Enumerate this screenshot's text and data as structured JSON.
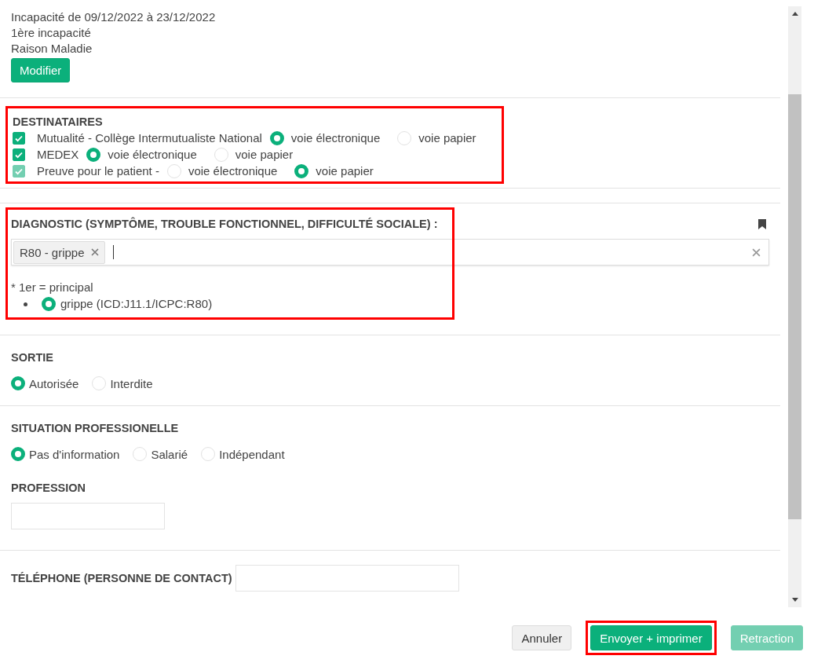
{
  "info": {
    "lines": [
      "Incapacité de 09/12/2022 à 23/12/2022",
      "1ère incapacité",
      "Raison Maladie"
    ],
    "button": "Modifier"
  },
  "destinataires": {
    "title": "DESTINATAIRES",
    "highlighted": true,
    "rows": [
      {
        "label": "Mutualité - Collège Intermutualiste National",
        "checked": true,
        "disabled": false,
        "options": [
          {
            "label": "voie électronique",
            "selected": true
          },
          {
            "label": "voie papier",
            "selected": false
          }
        ]
      },
      {
        "label": "MEDEX",
        "checked": true,
        "disabled": false,
        "options": [
          {
            "label": "voie électronique",
            "selected": true
          },
          {
            "label": "voie papier",
            "selected": false
          }
        ]
      },
      {
        "label": "Preuve pour le patient -",
        "checked": true,
        "disabled": true,
        "options": [
          {
            "label": "voie électronique",
            "selected": false
          },
          {
            "label": "voie papier",
            "selected": true
          }
        ]
      }
    ]
  },
  "diagnostic": {
    "title": "DIAGNOSTIC (SYMPTÔME, TROUBLE FONCTIONNEL, DIFFICULTÉ SOCIALE) :",
    "highlighted": true,
    "tags": [
      "R80 - grippe"
    ],
    "note": "* 1er = principal",
    "items": [
      {
        "label": "grippe (ICD:J11.1/ICPC:R80)",
        "selected": true
      }
    ]
  },
  "sortie": {
    "title": "SORTIE",
    "options": [
      {
        "label": "Autorisée",
        "selected": true
      },
      {
        "label": "Interdite",
        "selected": false
      }
    ]
  },
  "situation": {
    "title": "SITUATION PROFESSIONELLE",
    "options": [
      {
        "label": "Pas d'information",
        "selected": true
      },
      {
        "label": "Salarié",
        "selected": false
      },
      {
        "label": "Indépendant",
        "selected": false
      }
    ]
  },
  "profession": {
    "title": "PROFESSION"
  },
  "telephone": {
    "title": "TÉLÉPHONE (PERSONNE DE CONTACT)"
  },
  "buttons": [
    {
      "label": "Annuler",
      "kind": "secondary",
      "disabled": false,
      "highlighted": false
    },
    {
      "label": "Envoyer + imprimer",
      "kind": "primary",
      "disabled": false,
      "highlighted": true
    },
    {
      "label": "Retraction",
      "kind": "primary",
      "disabled": true,
      "highlighted": false
    }
  ]
}
